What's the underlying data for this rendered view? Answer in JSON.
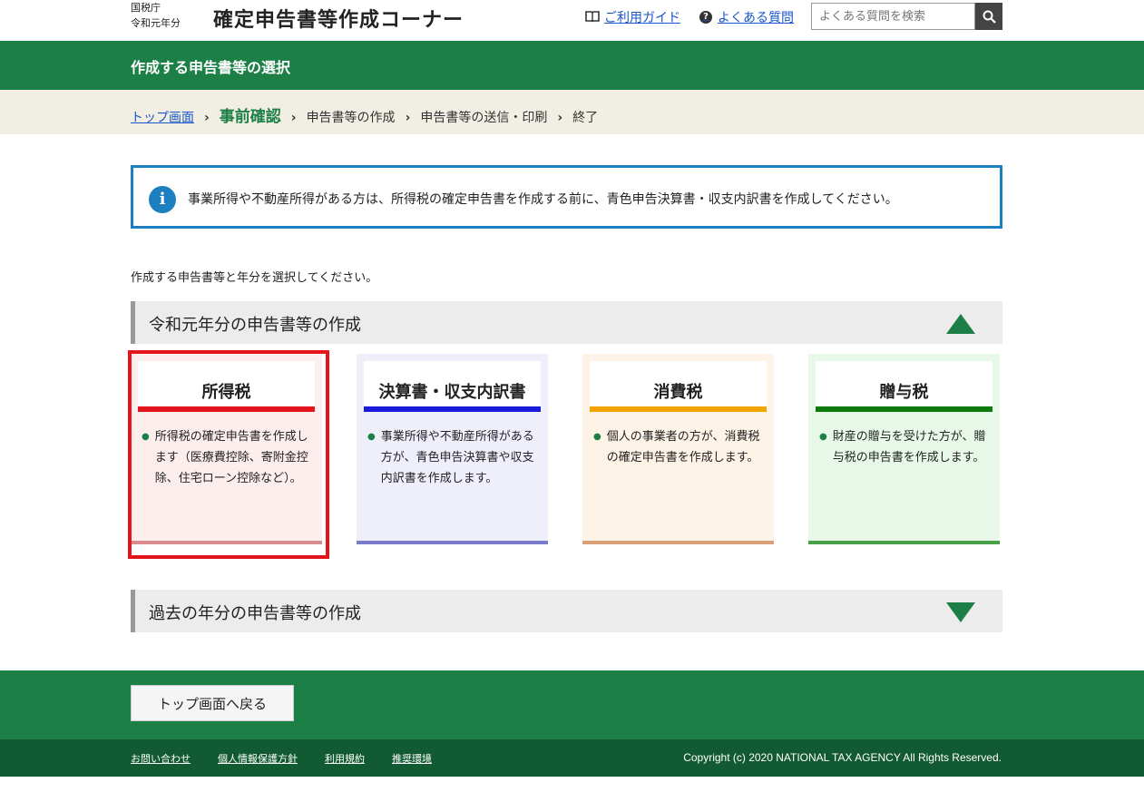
{
  "header": {
    "agency_line1": "国税庁",
    "agency_line2": "令和元年分",
    "site_title": "確定申告書等作成コーナー",
    "guide_link": "ご利用ガイド",
    "faq_link": "よくある質問",
    "search_placeholder": "よくある質問を検索"
  },
  "title_bar": {
    "title": "作成する申告書等の選択"
  },
  "breadcrumb": {
    "items": [
      "トップ画面",
      "事前確認",
      "申告書等の作成",
      "申告書等の送信・印刷",
      "終了"
    ],
    "separator": "›"
  },
  "info_box": {
    "icon": "info-icon",
    "text": "事業所得や不動産所得がある方は、所得税の確定申告書を作成する前に、青色申告決算書・収支内訳書を作成してください。"
  },
  "instruction": "作成する申告書等と年分を選択してください。",
  "current_year_section": {
    "label": "令和元年分の申告書等の作成",
    "expanded": true
  },
  "cards": [
    {
      "title": "所得税",
      "desc": "所得税の確定申告書を作成します（医療費控除、寄附金控除、住宅ローン控除など）。",
      "bg": "#fdeeee",
      "line": "#e3141c",
      "foot": "#d98c8c",
      "selected": true
    },
    {
      "title": "決算書・収支内訳書",
      "desc": "事業所得や不動産所得がある方が、青色申告決算書や収支内訳書を作成します。",
      "bg": "#efeffc",
      "line": "#1a1adb",
      "foot": "#7b7bcb",
      "selected": false
    },
    {
      "title": "消費税",
      "desc": "個人の事業者の方が、消費税の確定申告書を作成します。",
      "bg": "#fdf3e6",
      "line": "#f2a400",
      "foot": "#dba07a",
      "selected": false
    },
    {
      "title": "贈与税",
      "desc": "財産の贈与を受けた方が、贈与税の申告書を作成します。",
      "bg": "#e8f8e8",
      "line": "#0e7a0e",
      "foot": "#4aa04a",
      "selected": false
    }
  ],
  "past_year_section": {
    "label": "過去の年分の申告書等の作成",
    "expanded": false
  },
  "footer": {
    "back_button": "トップ画面へ戻る",
    "links": [
      "お問い合わせ",
      "個人情報保護方針",
      "利用規約",
      "推奨環境"
    ],
    "copyright": "Copyright (c) 2020 NATIONAL TAX AGENCY All Rights Reserved."
  },
  "colors": {
    "brand_green": "#1b7f46",
    "dark_green": "#125a32",
    "info_blue": "#1d7fc0",
    "link_blue": "#1a56c9",
    "selection_red": "#e3141c"
  }
}
